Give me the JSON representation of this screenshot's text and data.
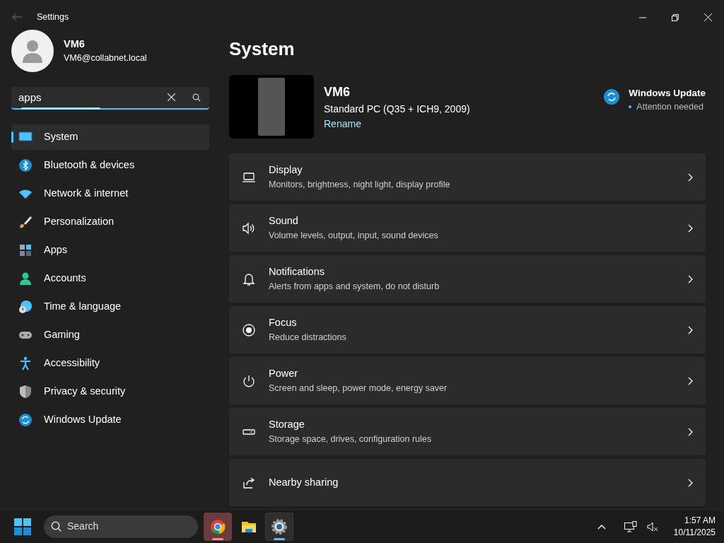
{
  "window": {
    "title": "Settings"
  },
  "account": {
    "name": "VM6",
    "email": "VM6@collabnet.local"
  },
  "search": {
    "value": "apps"
  },
  "sidebar": {
    "items": [
      {
        "label": "System",
        "selected": true
      },
      {
        "label": "Bluetooth & devices",
        "selected": false
      },
      {
        "label": "Network & internet",
        "selected": false
      },
      {
        "label": "Personalization",
        "selected": false
      },
      {
        "label": "Apps",
        "selected": false
      },
      {
        "label": "Accounts",
        "selected": false
      },
      {
        "label": "Time & language",
        "selected": false
      },
      {
        "label": "Gaming",
        "selected": false
      },
      {
        "label": "Accessibility",
        "selected": false
      },
      {
        "label": "Privacy & security",
        "selected": false
      },
      {
        "label": "Windows Update",
        "selected": false
      }
    ]
  },
  "page": {
    "title": "System"
  },
  "device": {
    "name": "VM6",
    "model": "Standard PC (Q35 + ICH9, 2009)",
    "rename": "Rename"
  },
  "update": {
    "title": "Windows Update",
    "status": "Attention needed"
  },
  "settings": [
    {
      "title": "Display",
      "subtitle": "Monitors, brightness, night light, display profile"
    },
    {
      "title": "Sound",
      "subtitle": "Volume levels, output, input, sound devices"
    },
    {
      "title": "Notifications",
      "subtitle": "Alerts from apps and system, do not disturb"
    },
    {
      "title": "Focus",
      "subtitle": "Reduce distractions"
    },
    {
      "title": "Power",
      "subtitle": "Screen and sleep, power mode, energy saver"
    },
    {
      "title": "Storage",
      "subtitle": "Storage space, drives, configuration rules"
    },
    {
      "title": "Nearby sharing"
    }
  ],
  "taskbar": {
    "search": "Search",
    "apps": [
      {
        "selected": false,
        "flashing": true
      },
      {
        "selected": false,
        "flashing": false
      },
      {
        "selected": true,
        "flashing": false
      }
    ],
    "time": "1:57 AM",
    "date": "10/11/2025"
  }
}
